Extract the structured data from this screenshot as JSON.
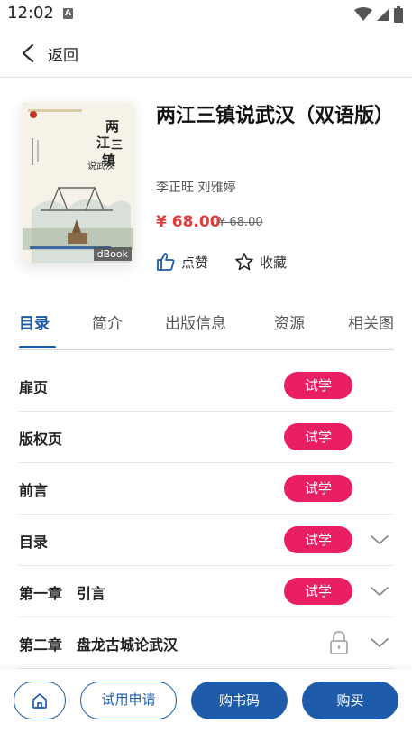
{
  "status_bar": {
    "time": "12:02",
    "notification_icon": "A"
  },
  "header": {
    "back_label": "返回"
  },
  "book": {
    "title": "两江三镇说武汉（双语版）",
    "authors": "李正旺 刘雅婷",
    "price": "¥ 68.00",
    "original_price": "¥ 68.00",
    "cover_badge": "dBook",
    "like_label": "点赞",
    "favorite_label": "收藏"
  },
  "tabs": [
    {
      "label": "目录",
      "active": true
    },
    {
      "label": "简介",
      "active": false
    },
    {
      "label": "出版信息",
      "active": false
    },
    {
      "label": "资源",
      "active": false
    },
    {
      "label": "相关图",
      "active": false
    }
  ],
  "toc": [
    {
      "title": "扉页",
      "trial": "试学"
    },
    {
      "title": "版权页",
      "trial": "试学"
    },
    {
      "title": "前言",
      "trial": "试学"
    },
    {
      "title": "目录",
      "trial": "试学"
    },
    {
      "title": "第一章　引言",
      "trial": "试学"
    },
    {
      "title": "第二章　盘龙古城论武汉"
    }
  ],
  "bottom_bar": {
    "apply_label": "试用申请",
    "code_label": "购书码",
    "buy_label": "购买"
  },
  "colors": {
    "accent": "#1e5ba8",
    "trial_button": "#e91e63",
    "price": "#e03c3c"
  }
}
